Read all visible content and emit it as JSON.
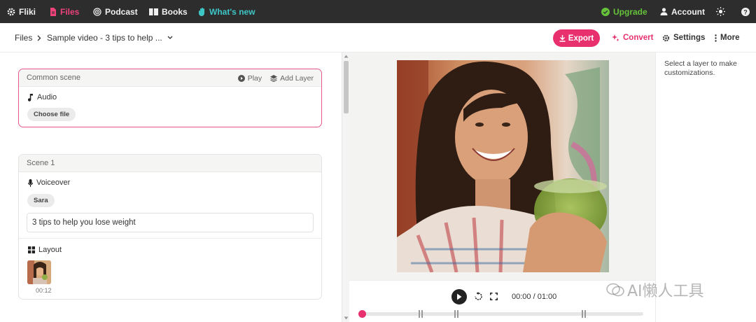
{
  "nav": {
    "brand": "Fliki",
    "files": "Files",
    "podcast": "Podcast",
    "books": "Books",
    "whats_new": "What's new",
    "upgrade": "Upgrade",
    "account": "Account"
  },
  "breadcrumb": {
    "root": "Files",
    "current": "Sample video - 3 tips to help ..."
  },
  "toolbar": {
    "export": "Export",
    "convert": "Convert",
    "settings": "Settings",
    "more": "More"
  },
  "common_scene": {
    "title": "Common scene",
    "play": "Play",
    "add_layer": "Add Layer",
    "audio_label": "Audio",
    "choose_file": "Choose file"
  },
  "scene1": {
    "title": "Scene 1",
    "voiceover_label": "Voiceover",
    "voice": "Sara",
    "script_text": "3 tips to help you lose weight",
    "layout_label": "Layout",
    "duration": "00:12"
  },
  "player": {
    "time": "00:00 / 01:00",
    "progress": 0.0
  },
  "side_panel": {
    "hint": "Select a layer to make customizations."
  },
  "watermark": "AI懒人工具",
  "colors": {
    "accent": "#e8306e",
    "nav_bg": "#2d2d2d",
    "upgrade": "#66c23a",
    "whats_new": "#3ec6c6"
  }
}
